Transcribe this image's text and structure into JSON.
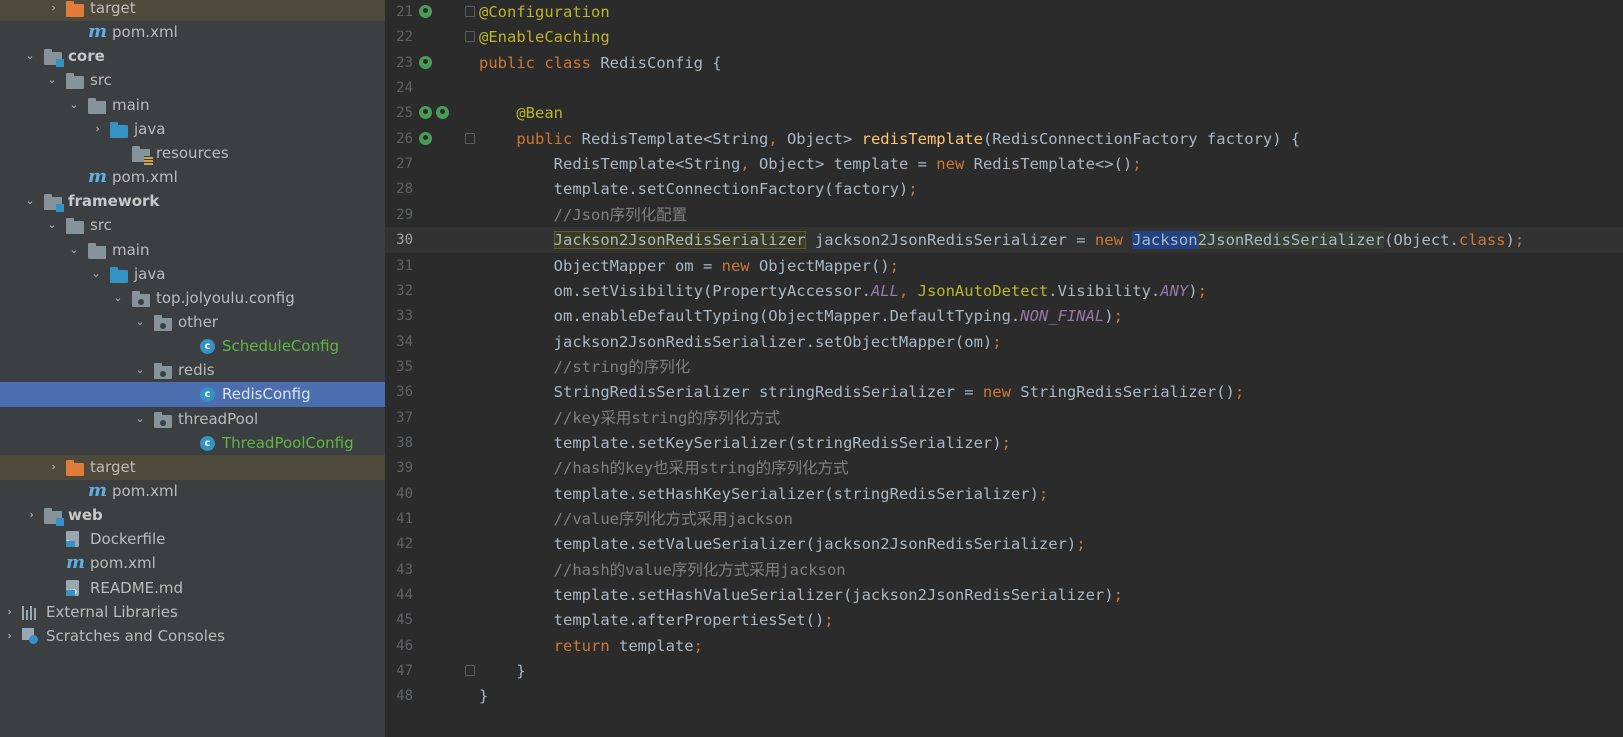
{
  "tree": {
    "rows": [
      {
        "label": "target",
        "icon": "folder-icon-orange"
      },
      {
        "label": "pom.xml",
        "icon": "maven-icon"
      },
      {
        "label": "core",
        "icon": "module-folder-icon"
      },
      {
        "label": "src",
        "icon": "folder-icon"
      },
      {
        "label": "main",
        "icon": "folder-icon"
      },
      {
        "label": "java",
        "icon": "source-folder-icon"
      },
      {
        "label": "resources",
        "icon": "resources-folder-icon"
      },
      {
        "label": "pom.xml",
        "icon": "maven-icon"
      },
      {
        "label": "framework",
        "icon": "module-folder-icon"
      },
      {
        "label": "src",
        "icon": "folder-icon"
      },
      {
        "label": "main",
        "icon": "folder-icon"
      },
      {
        "label": "java",
        "icon": "source-folder-icon"
      },
      {
        "label": "top.jolyoulu.config",
        "icon": "package-icon"
      },
      {
        "label": "other",
        "icon": "package-icon"
      },
      {
        "label": "ScheduleConfig",
        "icon": "class-icon"
      },
      {
        "label": "redis",
        "icon": "package-icon"
      },
      {
        "label": "RedisConfig",
        "icon": "class-icon"
      },
      {
        "label": "threadPool",
        "icon": "package-icon"
      },
      {
        "label": "ThreadPoolConfig",
        "icon": "class-icon"
      },
      {
        "label": "target",
        "icon": "folder-icon-orange"
      },
      {
        "label": "pom.xml",
        "icon": "maven-icon"
      },
      {
        "label": "web",
        "icon": "module-folder-icon"
      },
      {
        "label": "Dockerfile",
        "icon": "dockerfile-icon"
      },
      {
        "label": "pom.xml",
        "icon": "maven-icon"
      },
      {
        "label": "README.md",
        "icon": "markdown-icon"
      },
      {
        "label": "External Libraries",
        "icon": "libraries-icon"
      },
      {
        "label": "Scratches and Consoles",
        "icon": "scratches-icon"
      }
    ],
    "selected": "RedisConfig",
    "colors": {
      "background": "#3c3f41",
      "selection": "#4b6eaf",
      "excluded": "#4d4a3b",
      "vcs_added": "#62b543"
    }
  },
  "editor": {
    "line_numbers": [
      "21",
      "22",
      "23",
      "24",
      "25",
      "26",
      "27",
      "28",
      "29",
      "30",
      "31",
      "32",
      "33",
      "34",
      "35",
      "36",
      "37",
      "38",
      "39",
      "40",
      "41",
      "42",
      "43",
      "44",
      "45",
      "46",
      "47",
      "48"
    ],
    "current_line": "30",
    "lines": [
      [
        {
          "t": "@Configuration",
          "c": "an"
        }
      ],
      [
        {
          "t": "@EnableCaching",
          "c": "an"
        }
      ],
      [
        {
          "t": "public class ",
          "c": "kw"
        },
        {
          "t": "RedisConfig {"
        }
      ],
      [],
      [
        {
          "t": "    "
        },
        {
          "t": "@Bean",
          "c": "an"
        }
      ],
      [
        {
          "t": "    "
        },
        {
          "t": "public ",
          "c": "kw"
        },
        {
          "t": "RedisTemplate<String"
        },
        {
          "t": ", ",
          "c": "kw"
        },
        {
          "t": "Object> "
        },
        {
          "t": "redisTemplate",
          "c": "fn"
        },
        {
          "t": "(RedisConnectionFactory factory) {"
        }
      ],
      [
        {
          "t": "        RedisTemplate<String"
        },
        {
          "t": ", ",
          "c": "kw"
        },
        {
          "t": "Object> template = "
        },
        {
          "t": "new ",
          "c": "kw"
        },
        {
          "t": "RedisTemplate<>()"
        },
        {
          "t": ";",
          "c": "kw"
        }
      ],
      [
        {
          "t": "        template.setConnectionFactory(factory)"
        },
        {
          "t": ";",
          "c": "kw"
        }
      ],
      [
        {
          "t": "        "
        },
        {
          "t": "//Json序列化配置",
          "c": "cm"
        }
      ],
      [
        {
          "t": "        "
        },
        {
          "t": "Jackson2JsonRedisSerializer",
          "c": "hlw"
        },
        {
          "t": " jackson2JsonRedisSerializer = "
        },
        {
          "t": "new ",
          "c": "kw"
        },
        {
          "t": "Jackson",
          "c": "hl2"
        },
        {
          "t": "2JsonRedisSerializer",
          "c": "hl"
        },
        {
          "t": "(Object."
        },
        {
          "t": "class",
          "c": "kw"
        },
        {
          "t": ")"
        },
        {
          "t": ";",
          "c": "kw"
        }
      ],
      [
        {
          "t": "        ObjectMapper om = "
        },
        {
          "t": "new ",
          "c": "kw"
        },
        {
          "t": "ObjectMapper()"
        },
        {
          "t": ";",
          "c": "kw"
        }
      ],
      [
        {
          "t": "        om.setVisibility(PropertyAccessor."
        },
        {
          "t": "ALL",
          "c": "st"
        },
        {
          "t": ", ",
          "c": "kw"
        },
        {
          "t": "JsonAutoDetect",
          "c": "an"
        },
        {
          "t": ".Visibility."
        },
        {
          "t": "ANY",
          "c": "st"
        },
        {
          "t": ")"
        },
        {
          "t": ";",
          "c": "kw"
        }
      ],
      [
        {
          "t": "        om.enableDefaultTyping(ObjectMapper.DefaultTyping."
        },
        {
          "t": "NON_FINAL",
          "c": "st"
        },
        {
          "t": ")"
        },
        {
          "t": ";",
          "c": "kw"
        }
      ],
      [
        {
          "t": "        jackson2JsonRedisSerializer.setObjectMapper(om)"
        },
        {
          "t": ";",
          "c": "kw"
        }
      ],
      [
        {
          "t": "        "
        },
        {
          "t": "//string的序列化",
          "c": "cm"
        }
      ],
      [
        {
          "t": "        StringRedisSerializer stringRedisSerializer = "
        },
        {
          "t": "new ",
          "c": "kw"
        },
        {
          "t": "StringRedisSerializer()"
        },
        {
          "t": ";",
          "c": "kw"
        }
      ],
      [
        {
          "t": "        "
        },
        {
          "t": "//key采用string的序列化方式",
          "c": "cm"
        }
      ],
      [
        {
          "t": "        template.setKeySerializer(stringRedisSerializer)"
        },
        {
          "t": ";",
          "c": "kw"
        }
      ],
      [
        {
          "t": "        "
        },
        {
          "t": "//hash的key也采用string的序列化方式",
          "c": "cm"
        }
      ],
      [
        {
          "t": "        template.setHashKeySerializer(stringRedisSerializer)"
        },
        {
          "t": ";",
          "c": "kw"
        }
      ],
      [
        {
          "t": "        "
        },
        {
          "t": "//value序列化方式采用jackson",
          "c": "cm"
        }
      ],
      [
        {
          "t": "        template.setValueSerializer(jackson2JsonRedisSerializer)"
        },
        {
          "t": ";",
          "c": "kw"
        }
      ],
      [
        {
          "t": "        "
        },
        {
          "t": "//hash的value序列化方式采用jackson",
          "c": "cm"
        }
      ],
      [
        {
          "t": "        template.setHashValueSerializer(jackson2JsonRedisSerializer)"
        },
        {
          "t": ";",
          "c": "kw"
        }
      ],
      [
        {
          "t": "        template.afterPropertiesSet()"
        },
        {
          "t": ";",
          "c": "kw"
        }
      ],
      [
        {
          "t": "        "
        },
        {
          "t": "return ",
          "c": "kw"
        },
        {
          "t": "template"
        },
        {
          "t": ";",
          "c": "kw"
        }
      ],
      [
        {
          "t": "    }"
        }
      ],
      [
        {
          "t": "}"
        }
      ]
    ],
    "colors": {
      "background": "#2b2b2b",
      "keyword": "#cc7832",
      "annotation": "#bbb529",
      "method": "#ffc66d",
      "comment": "#808080",
      "static_field": "#9876aa",
      "text": "#a9b7c6",
      "line_number": "#606366"
    }
  }
}
